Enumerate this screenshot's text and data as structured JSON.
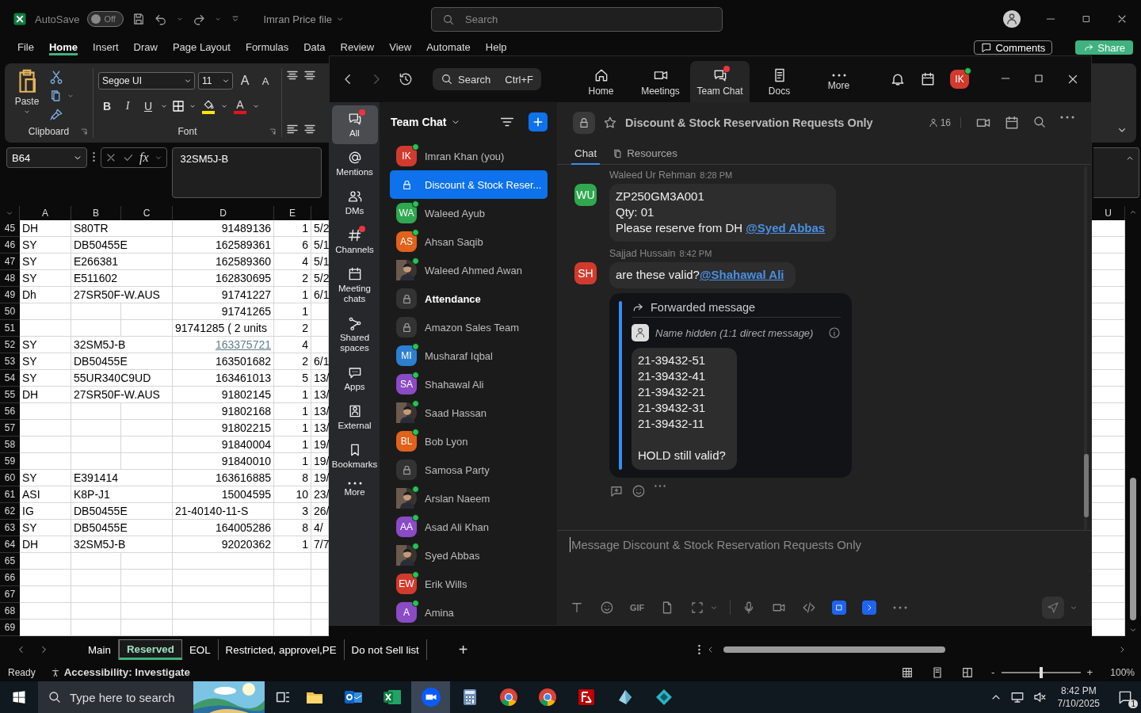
{
  "excel": {
    "autosave": {
      "label": "AutoSave",
      "toggle_text": "Off",
      "on": false
    },
    "file_name": "Imran Price file",
    "search_placeholder": "Search",
    "ribbon_tabs": [
      {
        "label": "File",
        "selected": false
      },
      {
        "label": "Home",
        "selected": true
      },
      {
        "label": "Insert",
        "selected": false
      },
      {
        "label": "Draw",
        "selected": false
      },
      {
        "label": "Page Layout",
        "selected": false
      },
      {
        "label": "Formulas",
        "selected": false
      },
      {
        "label": "Data",
        "selected": false
      },
      {
        "label": "Review",
        "selected": false
      },
      {
        "label": "View",
        "selected": false
      },
      {
        "label": "Automate",
        "selected": false
      },
      {
        "label": "Help",
        "selected": false
      }
    ],
    "comments_button": "Comments",
    "share_button": "Share",
    "clipboard": {
      "paste": "Paste",
      "group": "Clipboard"
    },
    "font": {
      "name": "Segoe UI",
      "size": "11",
      "group": "Font",
      "grow": "A",
      "shrink": "A",
      "bold": "B",
      "italic": "I",
      "underline": "U",
      "color_glyph": "A"
    },
    "name_box": "B64",
    "function_label": "fx",
    "formula": "32SM5J-B",
    "columns": [
      "A",
      "B",
      "C",
      "D",
      "E"
    ],
    "far_column": "U",
    "rows": [
      {
        "row": "45",
        "a": "DH",
        "b": "S80TR",
        "d": "91489136",
        "kind": "number",
        "e": "1",
        "f": "5/2"
      },
      {
        "row": "46",
        "a": "SY",
        "b": "DB50455E",
        "d": "162589361",
        "kind": "number",
        "e": "6",
        "f": "5/1"
      },
      {
        "row": "47",
        "a": "SY",
        "b": "E266381",
        "d": "162589360",
        "kind": "number",
        "e": "4",
        "f": "5/1"
      },
      {
        "row": "48",
        "a": "SY",
        "b": "E511602",
        "d": "162830695",
        "kind": "number",
        "e": "2",
        "f": "5/2"
      },
      {
        "row": "49",
        "a": "Dh",
        "b": "27SR50F-W.AUS",
        "d": "91741227",
        "kind": "number",
        "e": "1",
        "f": "6/1"
      },
      {
        "row": "50",
        "d": "91741265",
        "kind": "number",
        "e": "1"
      },
      {
        "row": "51",
        "d": "91741285 ( 2 units",
        "kind": "text",
        "e": "2"
      },
      {
        "row": "52",
        "a": "SY",
        "b": "32SM5J-B",
        "d": "163375721",
        "kind": "link",
        "e": "4"
      },
      {
        "row": "53",
        "a": "SY",
        "b": "DB50455E",
        "d": "163501682",
        "kind": "number",
        "e": "2",
        "f": "6/1"
      },
      {
        "row": "54",
        "a": "SY",
        "b": "55UR340C9UD",
        "d": "163461013",
        "kind": "number",
        "e": "5",
        "f": "13/"
      },
      {
        "row": "55",
        "a": "DH",
        "b": " 27SR50F-W.AUS",
        "d": "91802145",
        "kind": "number",
        "e": "1",
        "f": "13/"
      },
      {
        "row": "56",
        "d": "91802168",
        "kind": "number",
        "e": "1",
        "f": "13/"
      },
      {
        "row": "57",
        "d": "91802215",
        "kind": "number",
        "e": "1",
        "f": "13/"
      },
      {
        "row": "58",
        "d": "91840004",
        "kind": "number",
        "e": "1",
        "f": "19/"
      },
      {
        "row": "59",
        "d": "91840010",
        "kind": "number",
        "e": "1",
        "f": "19/"
      },
      {
        "row": "60",
        "a": "SY",
        "b": "E391414",
        "d": "163616885",
        "kind": "number",
        "e": "8",
        "f": "19/"
      },
      {
        "row": "61",
        "a": "ASI",
        "b": "K8P-J1",
        "d": "15004595",
        "kind": "number",
        "e": "10",
        "f": "23/"
      },
      {
        "row": "62",
        "a": "IG",
        "b": "DB50455E",
        "d": "21-40140-11-S",
        "kind": "text",
        "e": "3",
        "f": "26/"
      },
      {
        "row": "63",
        "a": "SY",
        "b": "DB50455E",
        "d": "164005286",
        "kind": "number",
        "e": "8",
        "f": "4/"
      },
      {
        "row": "64",
        "a": "DH",
        "b": "32SM5J-B",
        "d": "92020362",
        "kind": "number",
        "e": "1",
        "f": "7/7"
      },
      {
        "row": "65"
      },
      {
        "row": "66"
      },
      {
        "row": "67"
      },
      {
        "row": "68"
      },
      {
        "row": "69"
      }
    ],
    "sheet_tabs": [
      {
        "label": "Main",
        "selected": false
      },
      {
        "label": "Reserved",
        "selected": true
      },
      {
        "label": "EOL",
        "selected": false
      },
      {
        "label": "Restricted, approvel,PE",
        "selected": false
      },
      {
        "label": "Do not Sell list",
        "selected": false
      }
    ],
    "add_sheet": "+",
    "status": "Ready",
    "accessibility": "Accessibility: Investigate",
    "zoom_out": "-",
    "zoom_in": "+",
    "zoom_slider": {
      "level": 0.5
    },
    "zoom_percent": "100%"
  },
  "zoom_app": {
    "search": {
      "label": "Search",
      "shortcut": "Ctrl+F"
    },
    "nav_tabs": [
      {
        "label": "Home",
        "kind": "home",
        "selected": false,
        "badge": false
      },
      {
        "label": "Meetings",
        "kind": "video",
        "selected": false,
        "badge": false
      },
      {
        "label": "Team Chat",
        "kind": "chat",
        "selected": true,
        "badge": true
      },
      {
        "label": "Docs",
        "kind": "doc",
        "selected": false,
        "badge": false
      },
      {
        "label": "More",
        "kind": "more",
        "selected": false,
        "badge": false
      }
    ],
    "profile": {
      "initials": "IK",
      "color": "#d13b2e",
      "online": true
    },
    "rail": [
      {
        "label": "All",
        "kind": "chat",
        "selected": true,
        "badge": true
      },
      {
        "label": "Mentions",
        "kind": "at",
        "selected": false,
        "badge": false
      },
      {
        "label": "DMs",
        "kind": "people",
        "selected": false,
        "badge": false
      },
      {
        "label": "Channels",
        "kind": "hash",
        "selected": false,
        "badge": true
      },
      {
        "label": "Meeting chats",
        "kind": "calendar",
        "selected": false,
        "badge": false
      },
      {
        "label": "Shared spaces",
        "kind": "share",
        "selected": false,
        "badge": false
      },
      {
        "label": "Apps",
        "kind": "bubble",
        "selected": false,
        "badge": false
      },
      {
        "label": "External",
        "kind": "contact",
        "selected": false,
        "badge": false
      },
      {
        "label": "Bookmarks",
        "kind": "bookmark",
        "selected": false,
        "badge": false
      },
      {
        "label": "More",
        "kind": "more",
        "selected": false,
        "badge": false
      }
    ],
    "list_title": "Team Chat",
    "chats": [
      {
        "name": "Imran Khan (you)",
        "kind": "person",
        "initials": "IK",
        "color": "#d13b2e",
        "online": true,
        "selected": false,
        "unread": false
      },
      {
        "name": "Discount & Stock Reser...",
        "kind": "channel",
        "online": false,
        "selected": true,
        "unread": false
      },
      {
        "name": "Waleed Ayub",
        "kind": "person",
        "initials": "WA",
        "color": "#2fa84f",
        "online": true,
        "selected": false,
        "unread": false
      },
      {
        "name": "Ahsan Saqib",
        "kind": "person",
        "initials": "AS",
        "color": "#e0621b",
        "online": true,
        "selected": false,
        "unread": false
      },
      {
        "name": "Waleed Ahmed Awan",
        "online": true,
        "selected": false,
        "unread": false
      },
      {
        "name": "Attendance",
        "kind": "channel",
        "online": false,
        "selected": false,
        "unread": true
      },
      {
        "name": "Amazon Sales Team",
        "kind": "channel",
        "online": false,
        "selected": false,
        "unread": false
      },
      {
        "name": "Musharaf Iqbal",
        "kind": "person",
        "initials": "MI",
        "color": "#2d7fd2",
        "online": true,
        "selected": false,
        "unread": false
      },
      {
        "name": "Shahawal Ali",
        "kind": "person",
        "initials": "SA",
        "color": "#8a4bc5",
        "online": true,
        "selected": false,
        "unread": false
      },
      {
        "name": "Saad Hassan",
        "online": true,
        "selected": false,
        "unread": false
      },
      {
        "name": "Bob Lyon",
        "kind": "person",
        "initials": "BL",
        "color": "#e0621b",
        "online": true,
        "selected": false,
        "unread": false
      },
      {
        "name": "Samosa Party",
        "kind": "channel",
        "online": false,
        "selected": false,
        "unread": false
      },
      {
        "name": "Arslan Naeem",
        "online": true,
        "selected": false,
        "unread": false
      },
      {
        "name": "Asad Ali Khan",
        "kind": "person",
        "initials": "AA",
        "color": "#8a4bc5",
        "online": true,
        "selected": false,
        "unread": false
      },
      {
        "name": "Syed Abbas",
        "online": true,
        "selected": false,
        "unread": false
      },
      {
        "name": "Erik Wills",
        "kind": "person",
        "initials": "EW",
        "color": "#d13b2e",
        "online": true,
        "selected": false,
        "unread": false
      },
      {
        "name": "Amina",
        "kind": "person",
        "initials": "A",
        "color": "#8a4bc5",
        "online": true,
        "selected": false,
        "unread": false
      }
    ],
    "channel": {
      "title": "Discount & Stock Reservation Requests Only",
      "members": "16",
      "tabs": [
        {
          "label": "Chat",
          "selected": true
        },
        {
          "label": "Resources",
          "selected": false
        }
      ]
    },
    "messages": [
      {
        "sender": "Waleed Ur Rehman",
        "time": "8:28 PM",
        "initials": "WU",
        "color": "#2fa84f",
        "lines": [
          {
            "text": "ZP250GM3A001"
          },
          {
            "text": "Qty: 01"
          },
          {
            "text": "Please reserve from DH ",
            "mention": "@Syed Abbas"
          }
        ]
      },
      {
        "sender": "Sajjad Hussain",
        "time": "8:42 PM",
        "initials": "SH",
        "color": "#d13b2e",
        "lines": [
          {
            "text": "are these valid?",
            "mention": "@Shahawal Ali"
          }
        ],
        "forwarded": {
          "label": "Forwarded message",
          "from": "Name hidden (1:1 direct message)",
          "lines": [
            "21-39432-51",
            "21-39432-41",
            "21-39432-21",
            "21-39432-31",
            "21-39432-11"
          ],
          "note": "HOLD still valid?"
        }
      }
    ],
    "composer_placeholder": "Message Discount & Stock Reservation Requests Only",
    "gif_label": "GIF"
  },
  "taskbar": {
    "search_placeholder": "Type here to search",
    "apps": [
      {
        "kind": "folder",
        "selected": false
      },
      {
        "kind": "mail",
        "selected": false
      },
      {
        "kind": "sheet",
        "selected": false
      },
      {
        "kind": "meeting",
        "selected": true
      },
      {
        "kind": "calculator",
        "selected": false
      },
      {
        "kind": "browser",
        "selected": false
      },
      {
        "kind": "browser",
        "selected": false
      },
      {
        "kind": "ftp",
        "selected": false
      },
      {
        "kind": "crystal",
        "selected": false
      },
      {
        "kind": "diamond",
        "selected": false
      }
    ],
    "time": "8:42 PM",
    "date": "7/10/2025",
    "notifications": "1"
  }
}
